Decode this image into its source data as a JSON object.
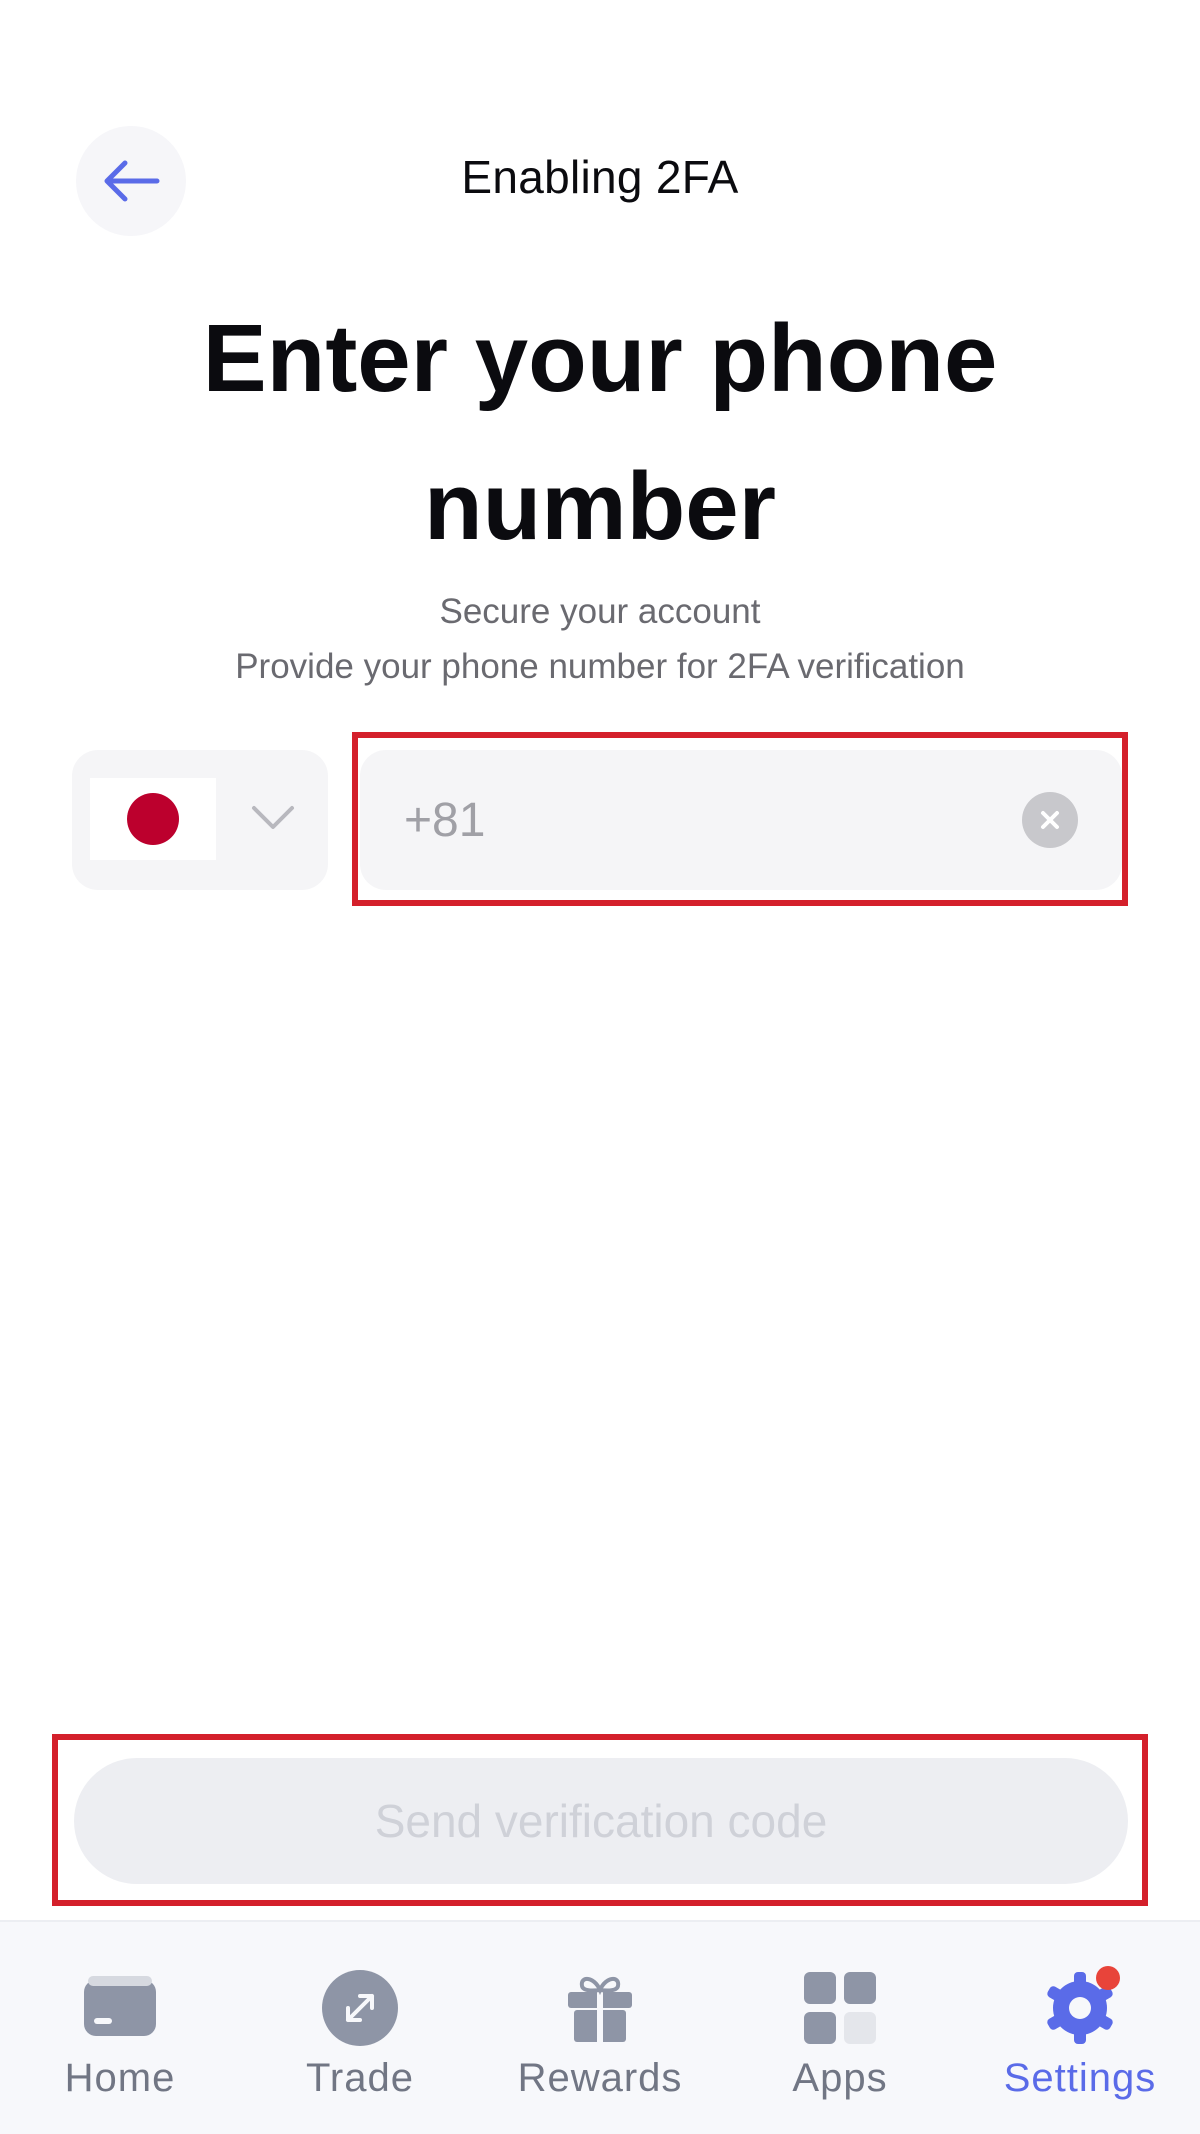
{
  "header": {
    "title": "Enabling 2FA"
  },
  "main": {
    "title_line1": "Enter your phone",
    "title_line2": "number",
    "subtitle_line1": "Secure your account",
    "subtitle_line2": "Provide your phone number for 2FA verification"
  },
  "phone": {
    "country_flag": "japan-flag",
    "value": "+81",
    "placeholder": ""
  },
  "actions": {
    "send_label": "Send verification code"
  },
  "nav": {
    "items": [
      {
        "label": "Home",
        "icon": "card-icon"
      },
      {
        "label": "Trade",
        "icon": "trade-arrows-icon"
      },
      {
        "label": "Rewards",
        "icon": "gift-icon"
      },
      {
        "label": "Apps",
        "icon": "grid-icon"
      },
      {
        "label": "Settings",
        "icon": "gear-icon"
      }
    ],
    "active": "Settings"
  },
  "colors": {
    "accent": "#5a6be8",
    "highlight": "#d4202b",
    "notification_dot": "#e8443a",
    "flag_red": "#bc002d"
  }
}
